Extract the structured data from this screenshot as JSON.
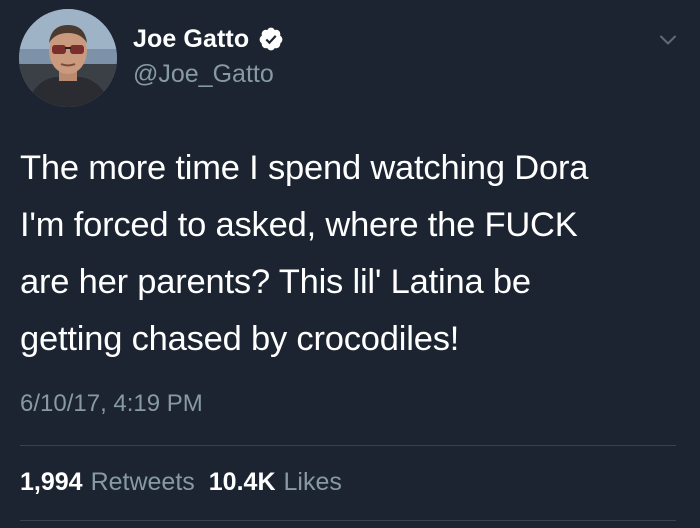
{
  "author": {
    "display_name": "Joe Gatto",
    "handle": "@Joe_Gatto",
    "verified": true
  },
  "tweet": {
    "lines": [
      "The more time I spend watching Dora",
      "I'm forced to asked, where the FUCK",
      "are her parents? This lil' Latina be",
      "getting chased by crocodiles!"
    ],
    "timestamp": "6/10/17, 4:19 PM"
  },
  "stats": {
    "retweets_count": "1,994",
    "retweets_label": "Retweets",
    "likes_count": "10.4K",
    "likes_label": "Likes"
  },
  "colors": {
    "background": "#1b2430",
    "secondary_text": "#8899a6",
    "verified_badge": "#ffffff",
    "divider": "#38444d"
  },
  "icons": {
    "verified": "verified-badge-icon",
    "more": "chevron-down-icon"
  }
}
